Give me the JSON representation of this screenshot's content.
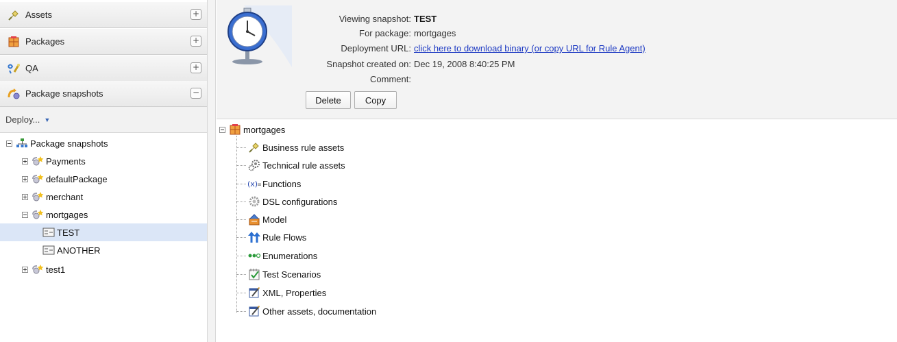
{
  "sidebar": {
    "sections": [
      {
        "label": "Assets",
        "icon": "assets-icon",
        "toggle": "+"
      },
      {
        "label": "Packages",
        "icon": "packages-icon",
        "toggle": "+"
      },
      {
        "label": "QA",
        "icon": "qa-icon",
        "toggle": "+"
      },
      {
        "label": "Package snapshots",
        "icon": "package-snapshots-icon",
        "toggle": "−"
      }
    ],
    "deploy_menu": {
      "label": "Deploy...",
      "caret": "▼"
    },
    "tree": {
      "root": "Package snapshots",
      "items": [
        "Payments",
        "defaultPackage",
        "merchant",
        "mortgages",
        "test1"
      ],
      "snapshots": [
        "TEST",
        "ANOTHER"
      ],
      "selected": "TEST"
    }
  },
  "snapshot_info": {
    "viewing_label": "Viewing snapshot:",
    "viewing_value": "TEST",
    "package_label": "For package:",
    "package_value": "mortgages",
    "url_label": "Deployment URL:",
    "url_link": "click here to download binary (or copy URL for Rule Agent)",
    "created_label": "Snapshot created on:",
    "created_value": "Dec 19, 2008 8:40:25 PM",
    "comment_label": "Comment:",
    "comment_value": "",
    "delete_label": "Delete",
    "copy_label": "Copy"
  },
  "assets_tree": {
    "root": "mortgages",
    "items": [
      {
        "label": "Business rule assets",
        "icon": "business-rule-icon"
      },
      {
        "label": "Technical rule assets",
        "icon": "technical-rule-icon"
      },
      {
        "label": "Functions",
        "icon": "functions-icon"
      },
      {
        "label": "DSL configurations",
        "icon": "dsl-icon"
      },
      {
        "label": "Model",
        "icon": "model-icon"
      },
      {
        "label": "Rule Flows",
        "icon": "rule-flows-icon"
      },
      {
        "label": "Enumerations",
        "icon": "enumerations-icon"
      },
      {
        "label": "Test Scenarios",
        "icon": "test-scenarios-icon"
      },
      {
        "label": "XML, Properties",
        "icon": "xml-properties-icon"
      },
      {
        "label": "Other assets, documentation",
        "icon": "other-assets-icon"
      }
    ]
  },
  "colors": {
    "link": "#1a37c2",
    "selection": "#dbe6f7",
    "panel_bg": "#f3f3f3"
  }
}
